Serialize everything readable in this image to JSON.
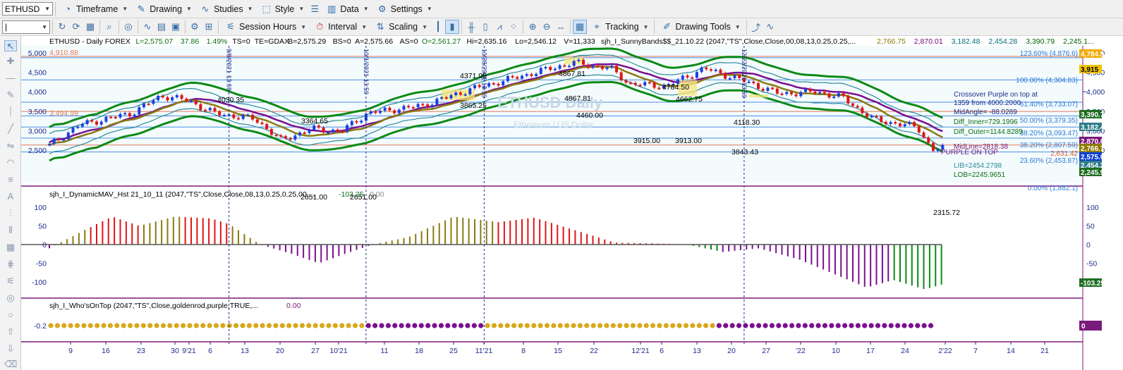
{
  "toolbar1": {
    "symbol": "ETHUSD",
    "items": [
      {
        "name": "timeframe",
        "label": "Timeframe",
        "icon": "clock-icon"
      },
      {
        "name": "drawing",
        "label": "Drawing",
        "icon": "pencil-icon"
      },
      {
        "name": "studies",
        "label": "Studies",
        "icon": "studies-icon"
      },
      {
        "name": "style",
        "label": "Style",
        "icon": "style-icon"
      },
      {
        "name": "data",
        "label": "Data",
        "icon": "data-icon"
      },
      {
        "name": "settings",
        "label": "Settings",
        "icon": "gear-icon"
      }
    ]
  },
  "toolbar2": {
    "session_hours": "Session Hours",
    "interval": "Interval",
    "scaling": "Scaling",
    "tracking": "Tracking",
    "drawing_tools": "Drawing Tools"
  },
  "header": {
    "title": "ETHUSD - Daily  FOREX",
    "last": "L=2,575.07",
    "change": "37.86",
    "change_pct": "1.49%",
    "ts": "TS=0",
    "exchange": "TE=GDAX",
    "bid": "B=2,575.29",
    "bid_size": "BS=0",
    "ask": "A=2,575.66",
    "ask_size": "AS=0",
    "open": "O=2,561.27",
    "high": "Hi=2,635.16",
    "low": "Lo=2,546.12",
    "volume": "V=11,333",
    "study": "sjh_I_SunnyBands$$_21.10.22 (2047,\"TS\",Close,Close,00,08,13,0.25,0.25,...",
    "study_values": [
      "2,766.75",
      "2,870.01",
      "3,182.48",
      "2,454.28",
      "3,390.79",
      "2,245.1..."
    ],
    "study_value_colors": [
      "#8b7a00",
      "#7a007a",
      "#006e7a",
      "#006e7a",
      "#006400",
      "#006400"
    ]
  },
  "watermark": {
    "title": "ETHUSD Daily",
    "subtitle": "Ethereum / US Dollar"
  },
  "annotations": {
    "price_labels": [
      "4,910.88",
      "3,494.99",
      "4030.35",
      "3364.65",
      "2651.00",
      "2651.00",
      "4371.95",
      "3865.25",
      "4867.81",
      "4867.81",
      "4460.00",
      "4784.50",
      "4662.75",
      "3915.00",
      "3913.00",
      "4118.30",
      "3843.43",
      "2315.72"
    ],
    "fib_labels": [
      "123.60% (4,876.6)",
      "100.00% (4,304.83)",
      "61.40% (3,733.07)",
      "50.00% (3,379.35)",
      "38.20% (3,093.47)",
      "38.20% (2,807.59)",
      "23.60% (2,453.87)",
      "0.00% (1,882.1)"
    ],
    "text_block": [
      "Crossover Purple on top at",
      "1359 from 4000.2000",
      "MidAngle= -88.0289",
      "Diff_Inner=729.1996",
      "Diff_Outer=1144.8289"
    ],
    "mid_line": "MidLine=2818.38",
    "purple_on_top": "PURPLE ON TOP",
    "lib": "LIB=2454.2798",
    "lob": "LOB=2245.9651",
    "vertical_dates": [
      "9/8/2021 13:59",
      "10/1/2021 13:59",
      "10/28/2021 13:59",
      "12/22/2021 13:59"
    ]
  },
  "panel1": {
    "axis": [
      "5,000",
      "4,500",
      "4,000",
      "3,500",
      "3,000",
      "2,500"
    ],
    "right_tags": [
      {
        "text": "4,784.5",
        "color": "#f2a900",
        "fg": "#fff"
      },
      {
        "text": "3,915",
        "color": "#f2c200",
        "fg": "#000"
      },
      {
        "text": "3,390.7",
        "color": "#1f6e22",
        "fg": "#fff"
      },
      {
        "text": "3,182.4",
        "color": "#2e7d8a",
        "fg": "#fff"
      },
      {
        "text": "2,870.0",
        "color": "#7a1a7a",
        "fg": "#fff"
      },
      {
        "text": "2,766.7",
        "color": "#8b7a00",
        "fg": "#fff"
      },
      {
        "text": "2,575.0",
        "color": "#0a3fd0",
        "fg": "#fff"
      },
      {
        "text": "2,454.2",
        "color": "#2e7d8a",
        "fg": "#fff"
      },
      {
        "text": "2,245.9",
        "color": "#1f6e22",
        "fg": "#fff"
      }
    ],
    "right_plain": [
      {
        "text": "2,631.42",
        "color": "#e05a2a"
      }
    ]
  },
  "panel2": {
    "title": "sjh_I_DynamicMAV_Hst 21_10_11 (2047,\"TS\",Close,Close,08,13,0.25,0.25,00,...",
    "value1": "-103.25",
    "value2": "0.00",
    "axis": [
      "100",
      "50",
      "0",
      "-50",
      "-100"
    ],
    "last_tag": "-103.25"
  },
  "panel3": {
    "title": "sjh_I_Who'sOnTop (2047,\"TS\",Close,goldenrod,purple,TRUE,...",
    "value": "0.00",
    "axis": [
      "-0.2"
    ],
    "last_tag": "0"
  },
  "x_axis": {
    "labels": [
      "9",
      "16",
      "23",
      "30",
      "9'21",
      "6",
      "13",
      "20",
      "27",
      "10'21",
      "11",
      "18",
      "25",
      "11'21",
      "8",
      "15",
      "22",
      "12'21",
      "6",
      "13",
      "20",
      "27",
      "'22",
      "10",
      "17",
      "24",
      "2'22",
      "7",
      "14",
      "21"
    ]
  },
  "colors": {
    "up": "#1d3fe0",
    "down": "#e01515",
    "green": "#0b8a14",
    "gold": "#d8a81a",
    "purple": "#7a0f8f",
    "olive": "#8b7a10",
    "teal": "#2b8a96"
  }
}
